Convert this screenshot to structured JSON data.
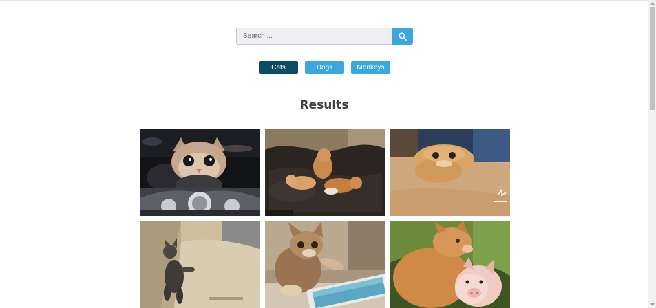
{
  "search": {
    "placeholder": "Search ...",
    "value": ""
  },
  "filters": [
    {
      "label": "Cats",
      "active": true
    },
    {
      "label": "Dogs",
      "active": false
    },
    {
      "label": "Monkeys",
      "active": false
    }
  ],
  "results": {
    "title": "Results",
    "images": [
      "cat-riding-motorcycle",
      "kittens-playing-on-leather-couch",
      "cat-face-squished-on-floor",
      "kitten-standing-on-rug",
      "kitten-pawing-smartphone",
      "cat-nuzzling-piglet"
    ]
  },
  "colors": {
    "accent": "#3aa7df",
    "active": "#0c4a66",
    "title": "#404040",
    "input_bg": "#eeeef3"
  },
  "icons": {
    "search_button": "search-icon",
    "scroll_up": "arrow-up-icon",
    "scroll_down": "arrow-down-icon"
  }
}
